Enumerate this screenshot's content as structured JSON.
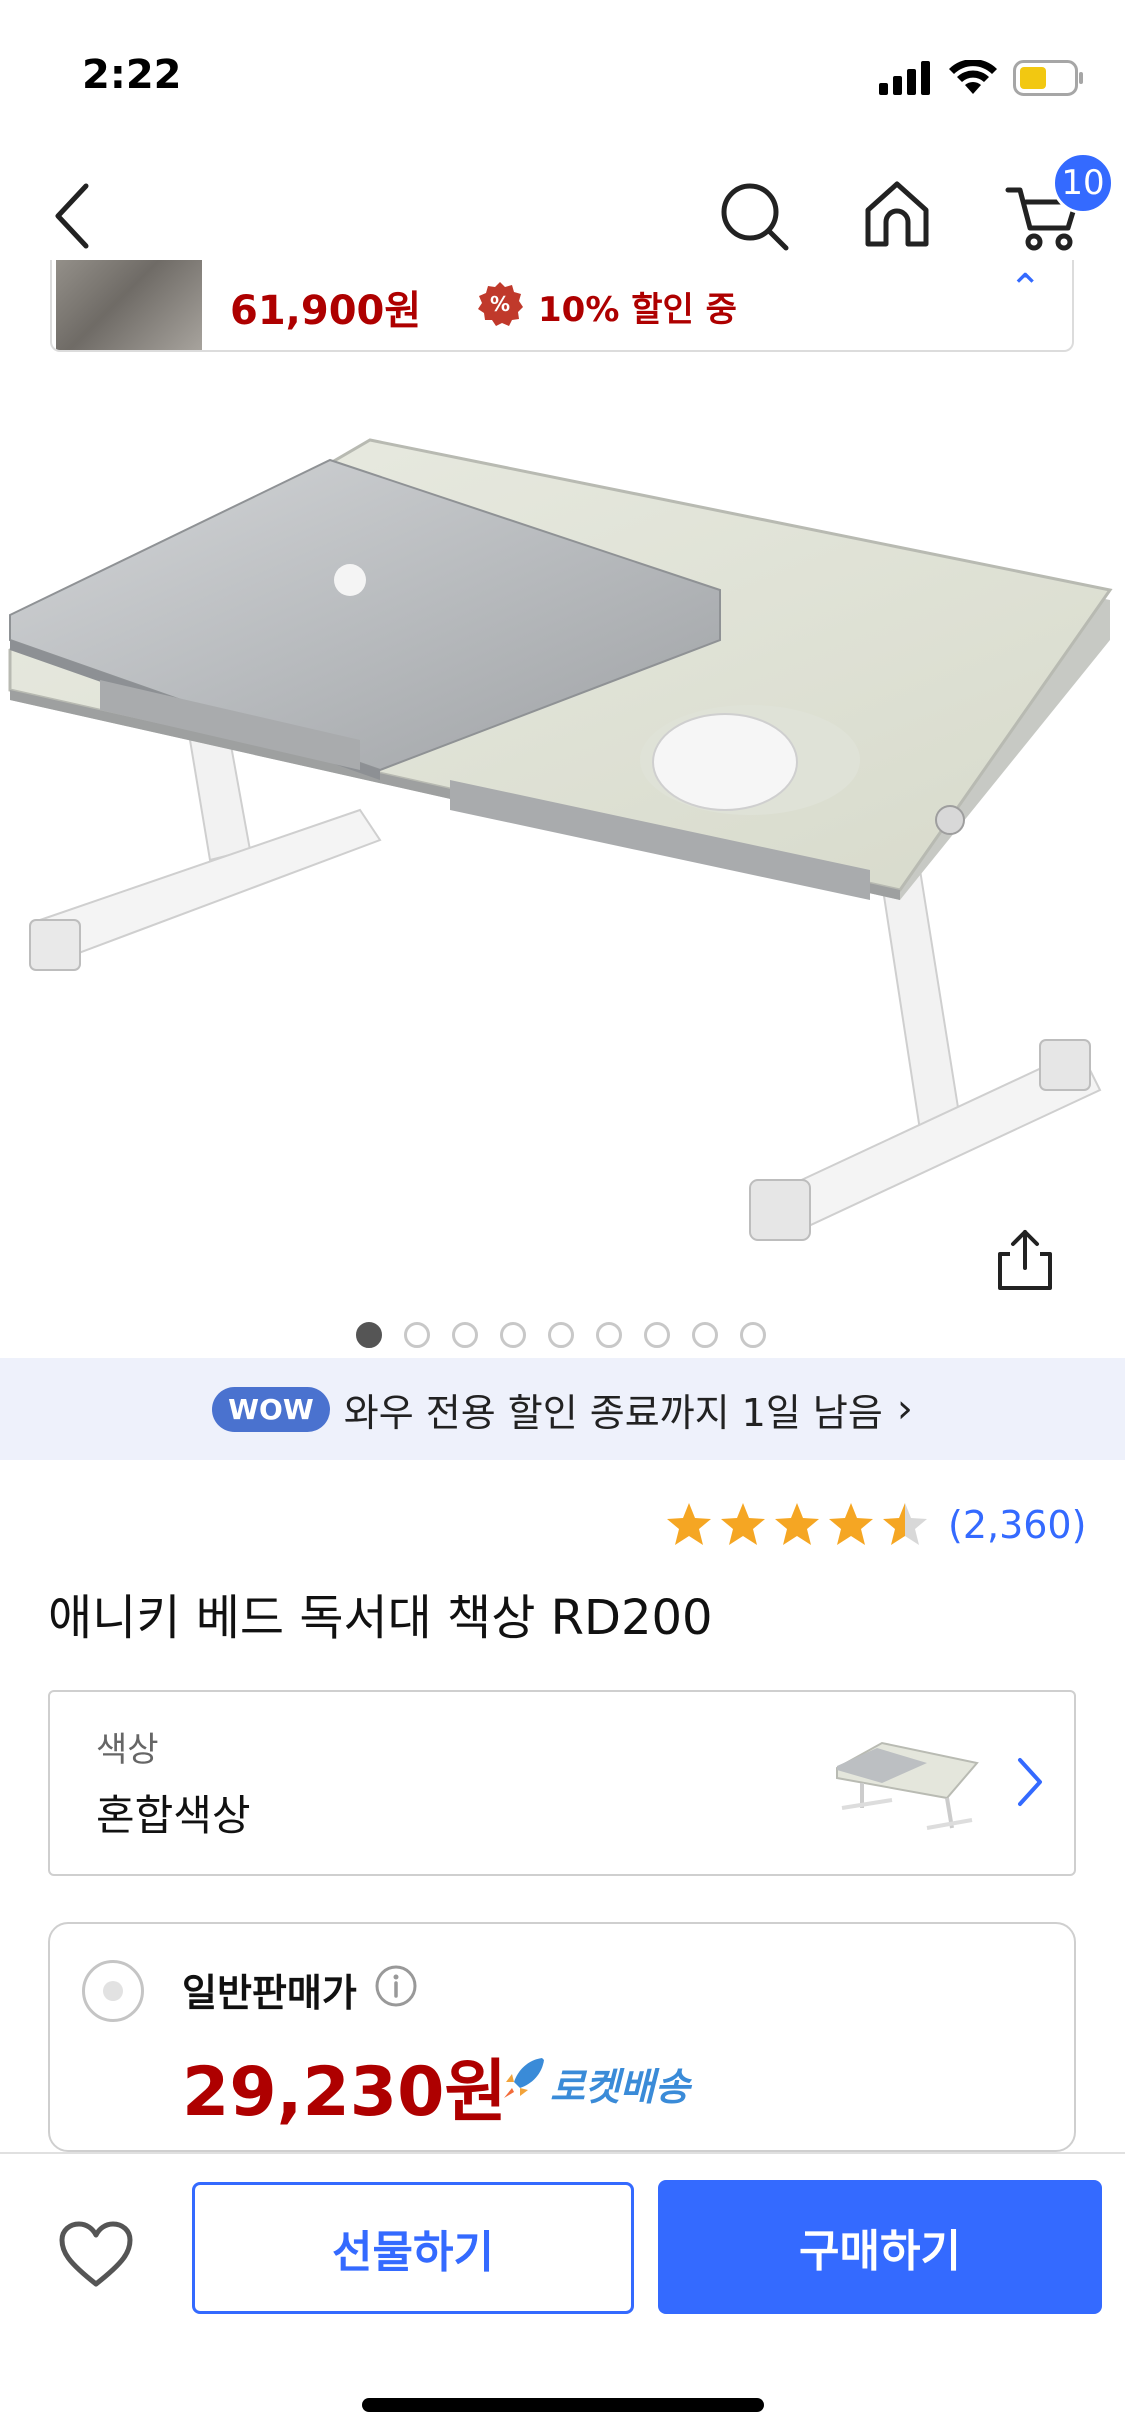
{
  "status_bar": {
    "time": "2:22"
  },
  "nav": {
    "cart_count": "10"
  },
  "sticky": {
    "price": "61,900원",
    "discount": "10% 할인 중"
  },
  "gallery": {
    "total": 9,
    "active": 0
  },
  "wow": {
    "pill": "WOW",
    "text": "와우 전용 할인 종료까지 1일 남음"
  },
  "rating": {
    "stars": 4.5,
    "count": "(2,360)"
  },
  "product": {
    "title": "애니키 베드 독서대 책상 RD200"
  },
  "option": {
    "label": "색상",
    "value": "혼합색상"
  },
  "price_card": {
    "label": "일반판매가",
    "price": "29,230원",
    "delivery": "로켓배송"
  },
  "bottom": {
    "gift_label": "선물하기",
    "buy_label": "구매하기"
  },
  "colors": {
    "accent": "#346aff",
    "price_red": "#ae0000",
    "star": "#f5a623",
    "rocket": "#3a8bd8"
  }
}
